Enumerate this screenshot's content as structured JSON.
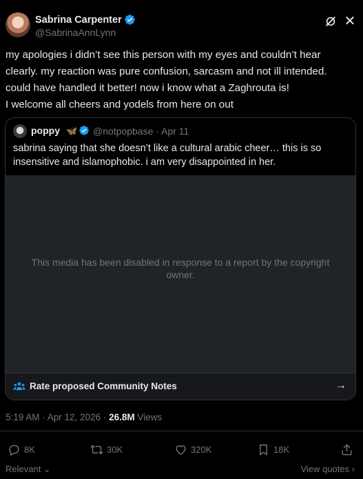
{
  "author": {
    "display_name": "Sabrina Carpenter",
    "handle": "@SabrinaAnnLynn",
    "avatar_icon": "user-avatar",
    "verified_icon": "verified-badge-icon"
  },
  "header_actions": {
    "grok_icon": "grok-icon",
    "close_icon": "close-icon"
  },
  "tweet": {
    "lines": [
      "my apologies i didn’t see this person with my eyes and couldn’t hear",
      "clearly. my reaction was pure confusion, sarcasm and not ill intended.",
      "could have handled it better! now i know what a Zaghrouta is!",
      "I welcome all cheers and yodels from here on out"
    ]
  },
  "quoted": {
    "display_name": "poppy",
    "emoji": "🦋",
    "handle_date": "@notpopbase · Apr 11",
    "lines": [
      "sabrina saying that she doesn’t like a cultural arabic cheer… this is so",
      "insensitive and islamophobic. i am very disappointed in her."
    ],
    "media_message_line1": "This media has been disabled in response to a report by the copyright",
    "media_message_line2": "owner.",
    "community_notes_label": "Rate proposed Community Notes",
    "community_notes_icon": "people-icon",
    "arrow_icon": "arrow-right-icon"
  },
  "meta": {
    "time_date": "5:19 AM · Apr 12, 2026 · ",
    "views_count": "26.8M",
    "views_label": " Views"
  },
  "actions": {
    "replies": "8K",
    "reposts": "30K",
    "likes": "320K",
    "bookmarks": "18K"
  },
  "footer": {
    "sort_label": "Relevant",
    "view_quotes_label": "View quotes"
  },
  "colors": {
    "background": "#000000",
    "text_primary": "#e7e9ea",
    "text_secondary": "#71767b",
    "accent_blue": "#1d9bf0",
    "border": "#2f3336",
    "media_bg": "#202327"
  }
}
